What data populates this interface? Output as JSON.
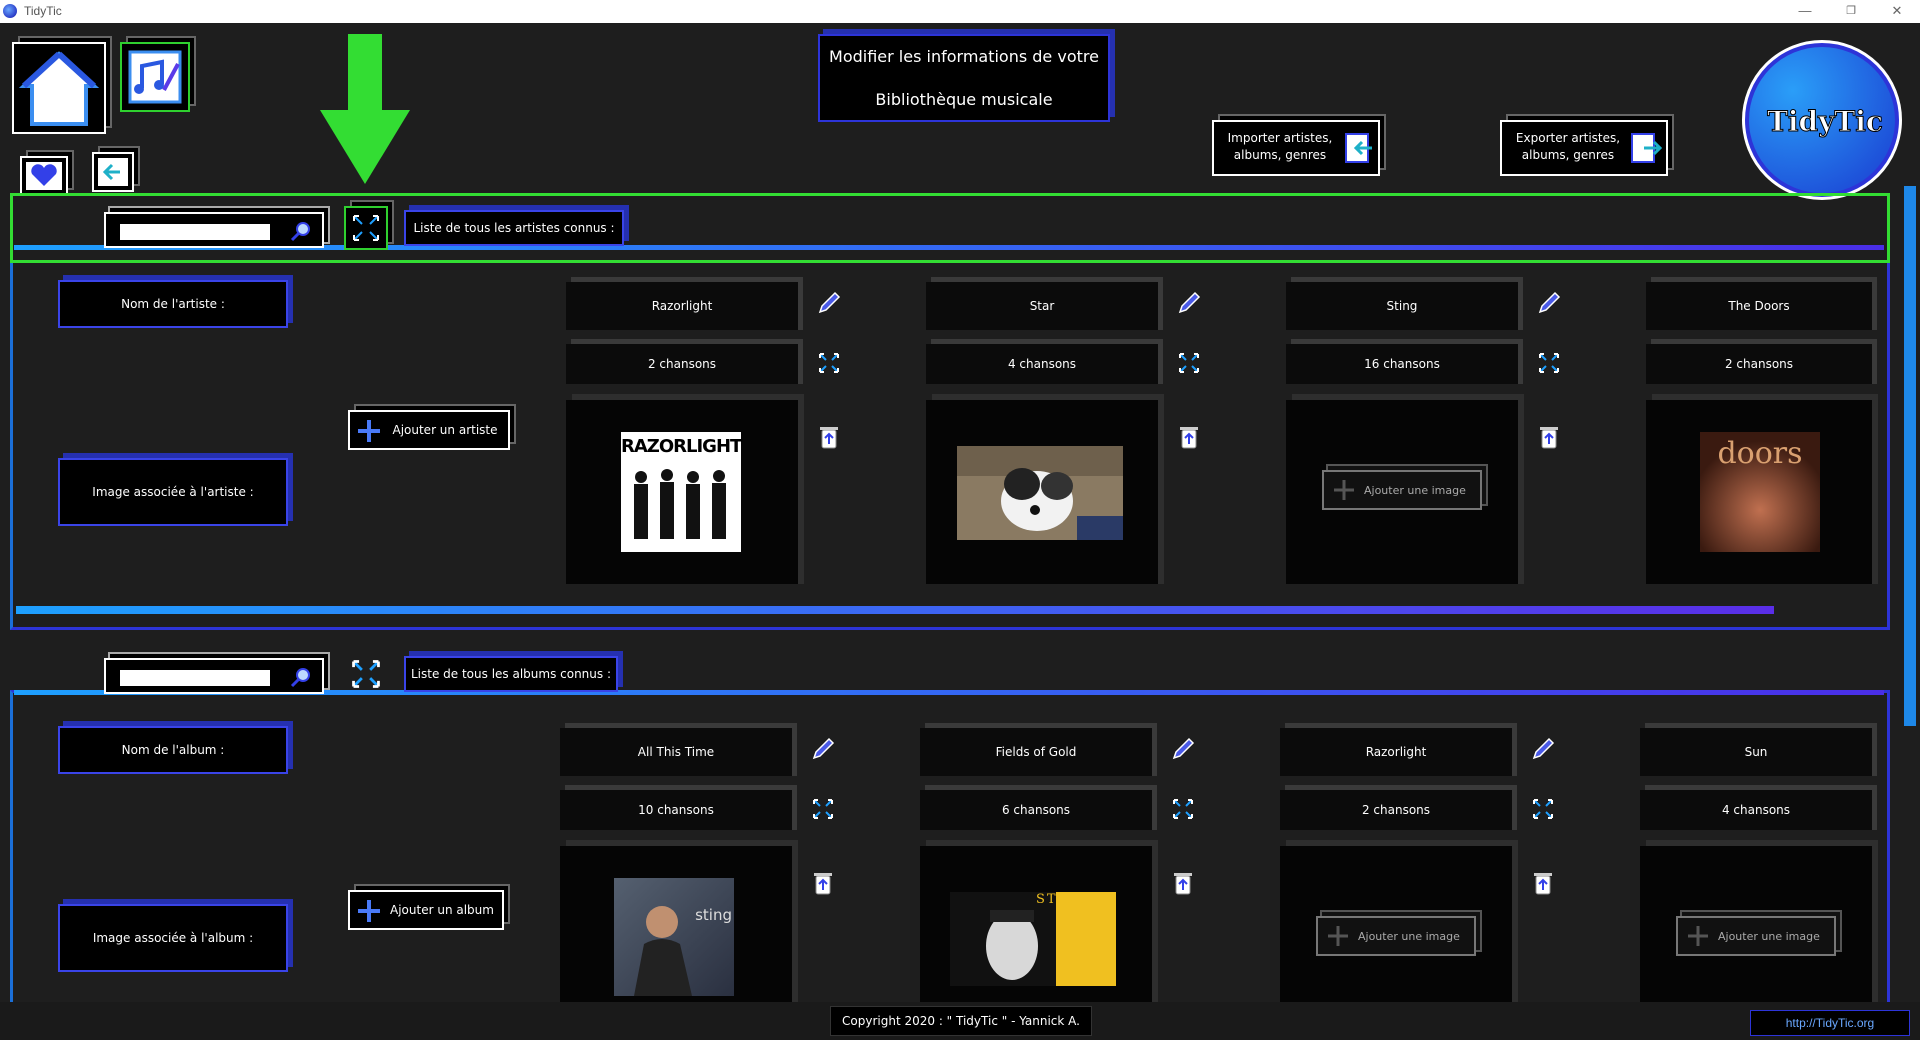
{
  "window": {
    "title": "TidyTic",
    "minimize": "—",
    "restore": "❐",
    "close": "✕"
  },
  "header": {
    "title_line1": "Modifier les informations de votre",
    "title_line2": "Bibliothèque musicale",
    "import_line1": "Importer artistes,",
    "import_line2": "albums, genres",
    "export_line1": "Exporter artistes,",
    "export_line2": "albums, genres",
    "logo_text": "TidyTic"
  },
  "artists": {
    "search_placeholder": "",
    "list_label": "Liste de tous les artistes connus :",
    "name_label": "Nom de l'artiste :",
    "image_label": "Image associée à l'artiste :",
    "add_label": "Ajouter un artiste",
    "items": [
      {
        "name": "Razorlight",
        "songs": "2 chansons",
        "image": "RAZORLIGHT"
      },
      {
        "name": "Star",
        "songs": "4 chansons",
        "image": ""
      },
      {
        "name": "Sting",
        "songs": "16 chansons",
        "image": ""
      },
      {
        "name": "The Doors",
        "songs": "2 chansons",
        "image": "doors"
      }
    ],
    "add_image_label": "Ajouter une image"
  },
  "albums": {
    "search_placeholder": "",
    "list_label": "Liste de tous les albums connus :",
    "name_label": "Nom de l'album :",
    "image_label": "Image associée à l'album :",
    "add_label": "Ajouter un album",
    "items": [
      {
        "name": "All This Time",
        "songs": "10 chansons"
      },
      {
        "name": "Fields of Gold",
        "songs": "6 chansons"
      },
      {
        "name": "Razorlight",
        "songs": "2 chansons"
      },
      {
        "name": "Sun",
        "songs": "4 chansons"
      }
    ],
    "add_image_label": "Ajouter une image",
    "album_image_text": "STING",
    "album_image_text2": "sting"
  },
  "footer": {
    "copyright": "Copyright 2020 : \" TidyTic \" - Yannick A.",
    "link": "http://TidyTic.org"
  },
  "colors": {
    "accent_green": "#33dd33",
    "accent_blue": "#2d34d8",
    "accent_cyan": "#1ea0ff"
  }
}
